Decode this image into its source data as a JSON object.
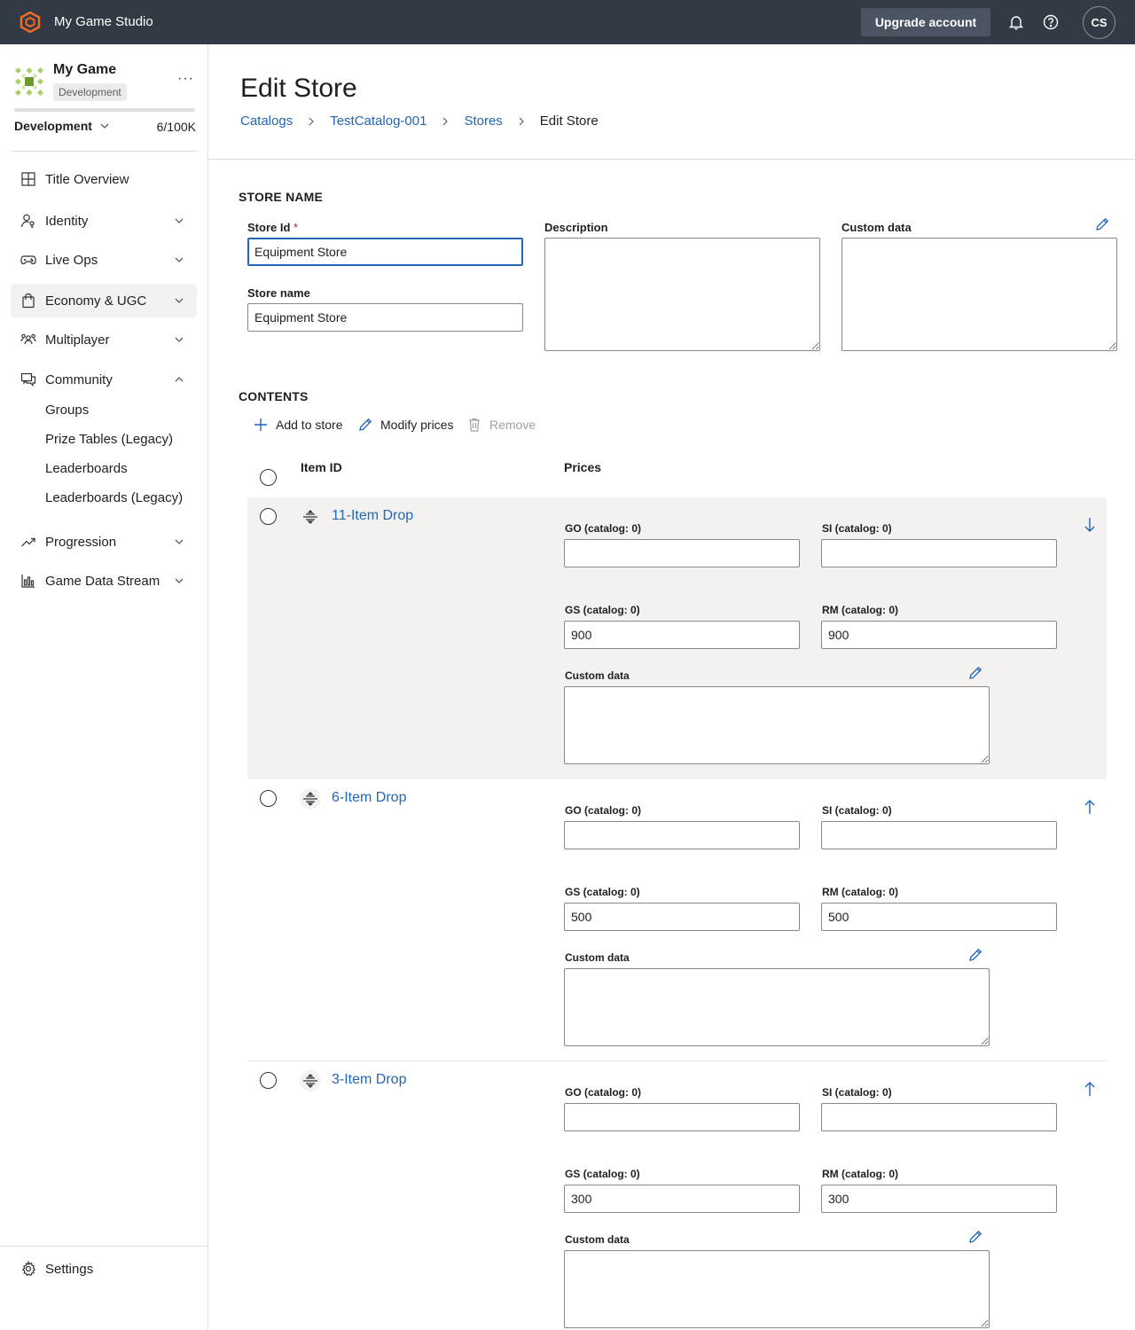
{
  "app": {
    "studio_name": "My Game Studio",
    "upgrade_label": "Upgrade account",
    "avatar_initials": "CS"
  },
  "sidebar": {
    "game_name": "My Game",
    "env_badge": "Development",
    "more_label": "···",
    "env_select": "Development",
    "usage": "6/100K",
    "usage_fraction": 6e-05,
    "items": [
      {
        "label": "Title Overview"
      },
      {
        "label": "Identity"
      },
      {
        "label": "Live Ops"
      },
      {
        "label": "Economy & UGC"
      },
      {
        "label": "Multiplayer"
      },
      {
        "label": "Community"
      },
      {
        "label": "Progression"
      },
      {
        "label": "Game Data Stream"
      }
    ],
    "community_sub": [
      "Groups",
      "Prize Tables (Legacy)",
      "Leaderboards",
      "Leaderboards (Legacy)"
    ],
    "settings": "Settings"
  },
  "page": {
    "title": "Edit Store",
    "breadcrumb": [
      "Catalogs",
      "TestCatalog-001",
      "Stores",
      "Edit Store"
    ]
  },
  "store": {
    "section_title": "STORE NAME",
    "id_label": "Store Id",
    "id_required": "*",
    "id_value": "Equipment Store",
    "name_label": "Store name",
    "name_value": "Equipment Store",
    "description_label": "Description",
    "custom_data_label": "Custom data"
  },
  "contents": {
    "section_title": "CONTENTS",
    "commands": {
      "add": "Add to store",
      "modify": "Modify prices",
      "remove": "Remove"
    },
    "col_item_id": "Item ID",
    "col_prices": "Prices",
    "custom_data_label": "Custom data",
    "rows": [
      {
        "item": "11-Item Drop",
        "go_label": "GO (catalog: 0)",
        "si_label": "SI (catalog: 0)",
        "gs_label": "GS (catalog: 0)",
        "rm_label": "RM (catalog: 0)",
        "go": "",
        "si": "",
        "gs": "900",
        "rm": "900",
        "arrow": "down"
      },
      {
        "item": "6-Item Drop",
        "go_label": "GO (catalog: 0)",
        "si_label": "SI (catalog: 0)",
        "gs_label": "GS (catalog: 0)",
        "rm_label": "RM (catalog: 0)",
        "go": "",
        "si": "",
        "gs": "500",
        "rm": "500",
        "arrow": "up"
      },
      {
        "item": "3-Item Drop",
        "go_label": "GO (catalog: 0)",
        "si_label": "SI (catalog: 0)",
        "gs_label": "GS (catalog: 0)",
        "rm_label": "RM (catalog: 0)",
        "go": "",
        "si": "",
        "gs": "300",
        "rm": "300",
        "arrow": "up"
      }
    ]
  }
}
